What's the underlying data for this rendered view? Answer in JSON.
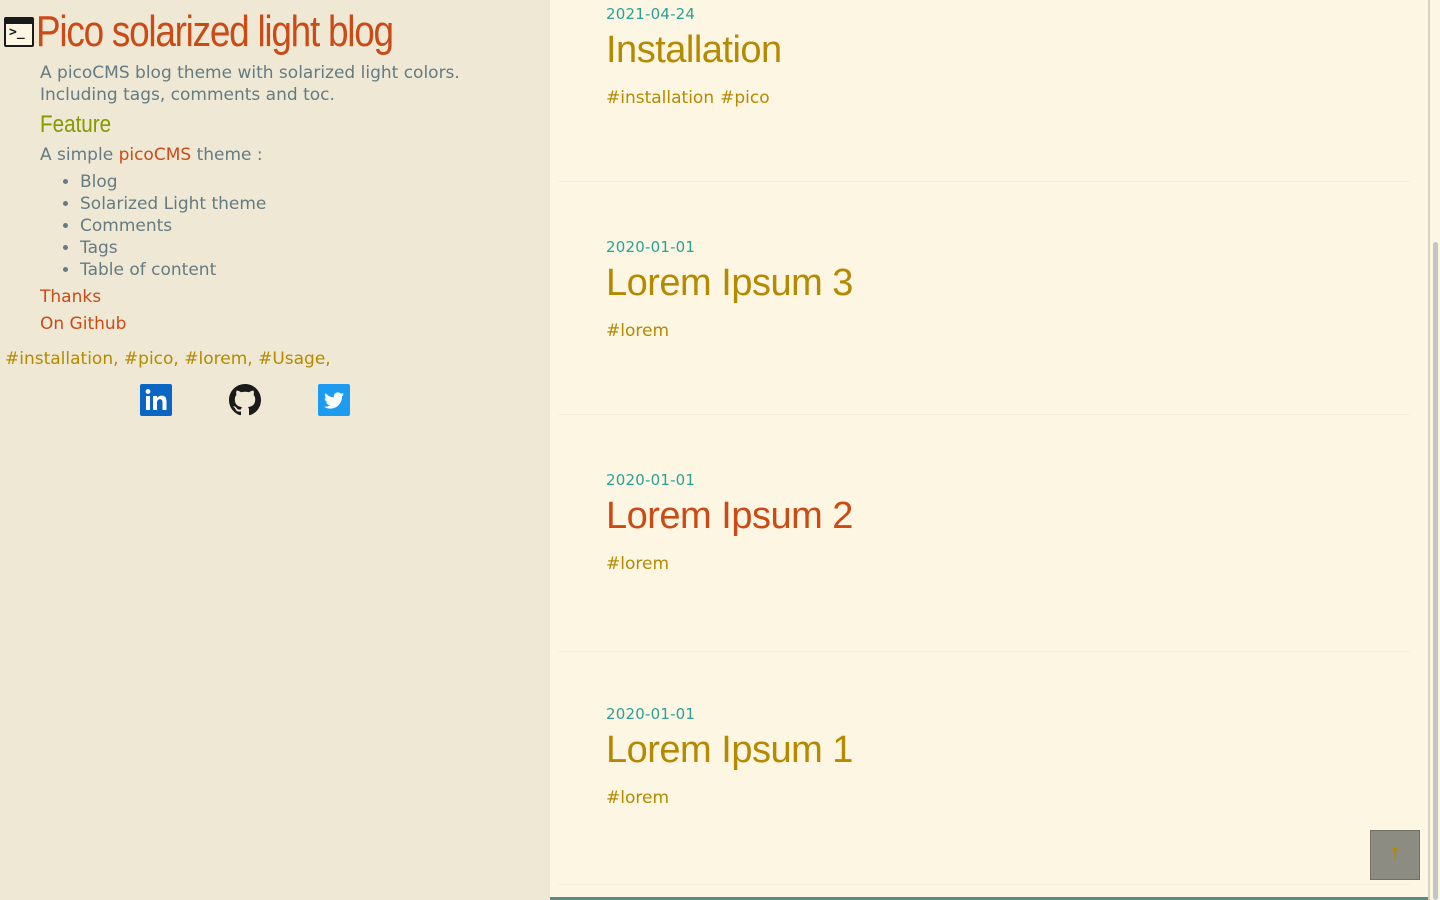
{
  "sidebar": {
    "site_title": "Pico solarized light blog",
    "description": "A picoCMS blog theme with solarized light colors. Including tags, comments and toc.",
    "feature_heading": "Feature",
    "intro_prefix": "A simple",
    "intro_link": "picoCMS",
    "intro_suffix": "theme :",
    "features": [
      "Blog",
      "Solarized Light theme",
      "Comments",
      "Tags",
      "Table of content"
    ],
    "links": {
      "thanks": "Thanks",
      "github": "On Github"
    },
    "tag_cloud": [
      "#installation,",
      "#pico,",
      "#lorem,",
      "#Usage,"
    ],
    "social": [
      "linkedin-icon",
      "github-icon",
      "twitter-icon"
    ]
  },
  "posts": [
    {
      "date": "2021-04-24",
      "title": "Installation",
      "tags": [
        "#installation",
        "#pico"
      ]
    },
    {
      "date": "2020-01-01",
      "title": "Lorem Ipsum 3",
      "tags": [
        "#lorem"
      ]
    },
    {
      "date": "2020-01-01",
      "title": "Lorem Ipsum 2",
      "tags": [
        "#lorem"
      ]
    },
    {
      "date": "2020-01-01",
      "title": "Lorem Ipsum 1",
      "tags": [
        "#lorem"
      ]
    }
  ],
  "back_to_top": "↑",
  "colors": {
    "sidebar_bg": "#eee8d5",
    "main_bg": "#fdf6e3",
    "orange": "#cb4b16",
    "yellow": "#b58900",
    "green": "#859900",
    "cyan": "#2aa198",
    "base00": "#657b83"
  }
}
